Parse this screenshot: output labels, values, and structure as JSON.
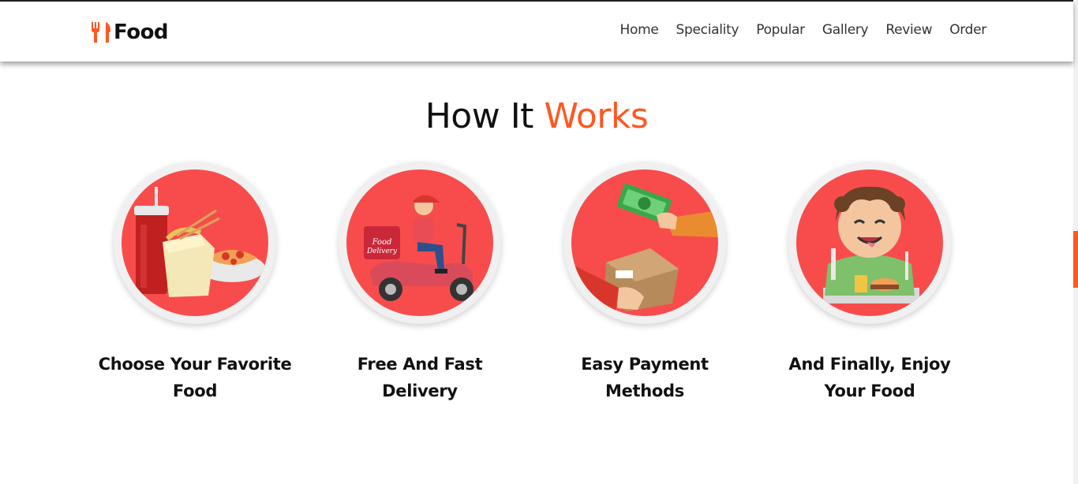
{
  "brand": {
    "name": "Food",
    "icon": "utensils-icon",
    "accent_color": "#ff5722"
  },
  "nav": {
    "items": [
      {
        "label": "Home"
      },
      {
        "label": "Speciality"
      },
      {
        "label": "Popular"
      },
      {
        "label": "Gallery"
      },
      {
        "label": "Review"
      },
      {
        "label": "Order"
      }
    ]
  },
  "section": {
    "title_prefix": "How It",
    "title_accent": "Works"
  },
  "steps": [
    {
      "title": "Choose Your Favorite Food",
      "image": "fast-food-meal-illustration"
    },
    {
      "title": "Free And Fast Delivery",
      "image": "scooter-delivery-illustration"
    },
    {
      "title": "Easy Payment Methods",
      "image": "cash-for-package-illustration"
    },
    {
      "title": "And Finally, Enjoy Your Food",
      "image": "happy-kid-eating-illustration"
    }
  ],
  "colors": {
    "circle_fill": "#f84c4c",
    "circle_ring": "#f0f0f0"
  }
}
